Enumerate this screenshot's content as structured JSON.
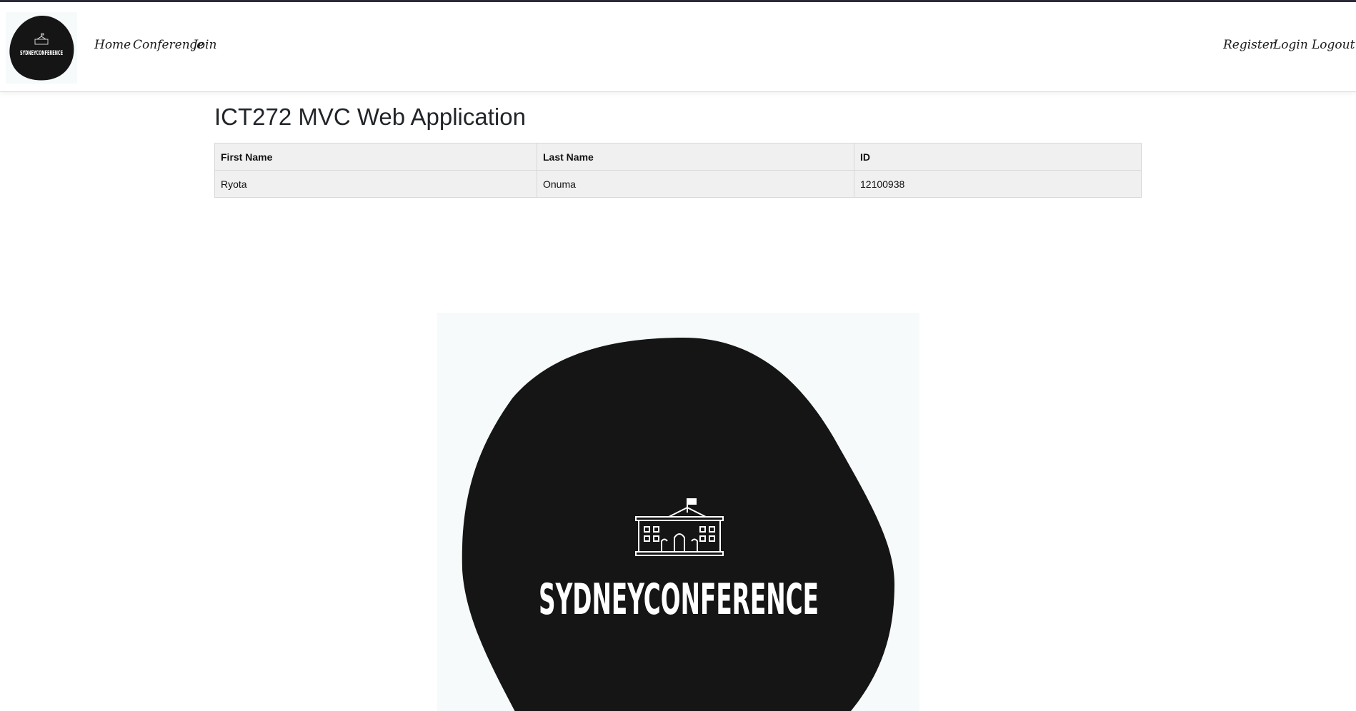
{
  "nav": {
    "brand_text": "SYDNEYCONFERENCE",
    "left_links": [
      {
        "label": "Home"
      },
      {
        "label": "Conference"
      },
      {
        "label": "Join"
      }
    ],
    "right_links": [
      {
        "label": "Register"
      },
      {
        "label": "Login"
      },
      {
        "label": "Logout"
      }
    ]
  },
  "main": {
    "title": "ICT272 MVC Web Application",
    "table": {
      "headers": [
        "First Name",
        "Last Name",
        "ID"
      ],
      "rows": [
        [
          "Ryota",
          "Onuma",
          "12100938"
        ]
      ]
    },
    "hero_logo_text": "SYDNEYCONFERENCE"
  },
  "colors": {
    "logo_blob": "#151515",
    "logo_bg": "#f6fafa",
    "table_bg": "#f0f0f0",
    "top_line": "#2b2b3a"
  },
  "icons": {
    "brand": "building-icon",
    "hero": "building-icon"
  }
}
